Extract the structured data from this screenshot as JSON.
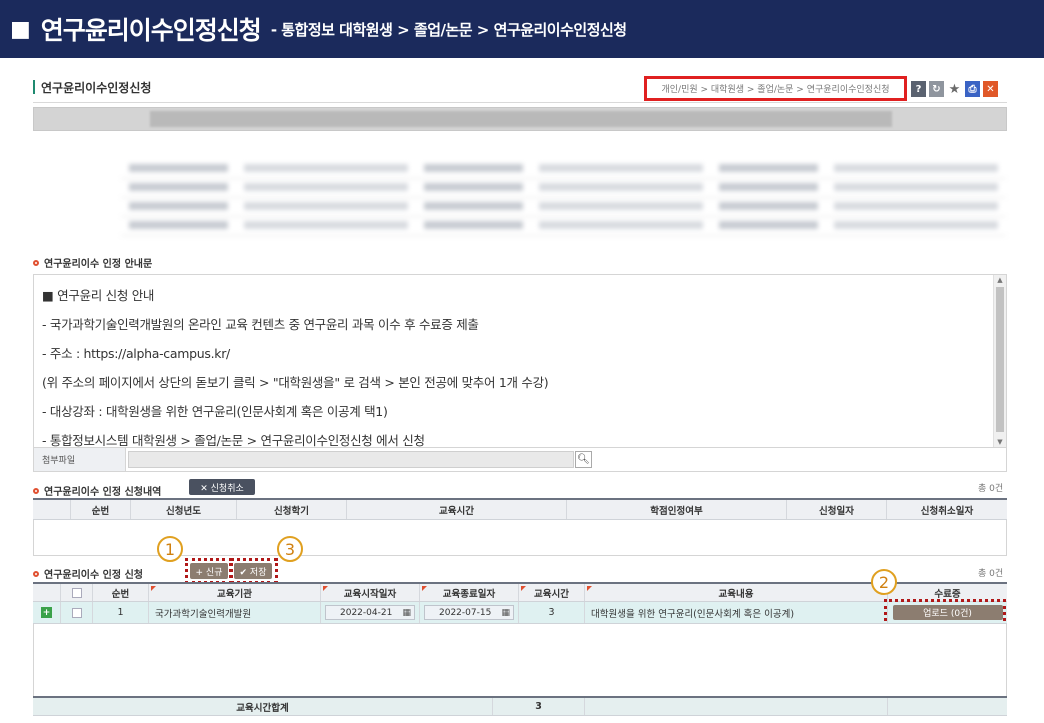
{
  "banner": {
    "title": "연구윤리이수인정신청",
    "sub": "- 통합정보 대학원생 > 졸업/논문 > 연구윤리이수인정신청"
  },
  "page": {
    "title": "연구윤리이수인정신청",
    "breadcrumb": "개인/민원 > 대학원생 > 졸업/논문 > 연구윤리이수인정신청"
  },
  "notice": {
    "title": "연구윤리이수 인정 안내문",
    "lines": [
      "■  연구윤리 신청 안내",
      "  - 국가과학기술인력개발원의 온라인 교육 컨텐츠 중 연구윤리 과목 이수 후 수료증 제출",
      "  - 주소 :  https://alpha-campus.kr/",
      "     (위 주소의 페이지에서 상단의 돋보기 클릭 > \"대학원생을\" 로 검색 > 본인 전공에 맞추어 1개 수강)",
      "  - 대상강좌 : 대학원생을 위한 연구윤리(인문사회계 혹은 이공계 택1)",
      "  - 통합정보시스템 대학원생 > 졸업/논문 > 연구윤리이수인정신청 에서 신청"
    ],
    "attach_label": "첨부파일"
  },
  "history": {
    "title": "연구윤리이수 인정 신청내역",
    "cancel_button": "✕ 신청취소",
    "count": "총 0건",
    "columns": [
      "순번",
      "신청년도",
      "신청학기",
      "교육시간",
      "학점인정여부",
      "신청일자",
      "신청취소일자"
    ]
  },
  "apply": {
    "title": "연구윤리이수 인정 신청",
    "new_button": "+ 신규",
    "save_button": "✔ 저장",
    "count": "총 0건",
    "columns": [
      "순번",
      "교육기관",
      "교육시작일자",
      "교육종료일자",
      "교육시간",
      "교육내용",
      "수료증"
    ],
    "rows": [
      {
        "no": "1",
        "institution": "국가과학기술인력개발원",
        "start_date": "2022-04-21",
        "end_date": "2022-07-15",
        "hours": "3",
        "content": "대학원생을 위한 연구윤리(인문사회계 혹은 이공계)",
        "upload": "업로드 (0건)"
      }
    ],
    "total_label": "교육시간합계",
    "total_hours": "3"
  },
  "callouts": [
    "1",
    "2",
    "3"
  ]
}
